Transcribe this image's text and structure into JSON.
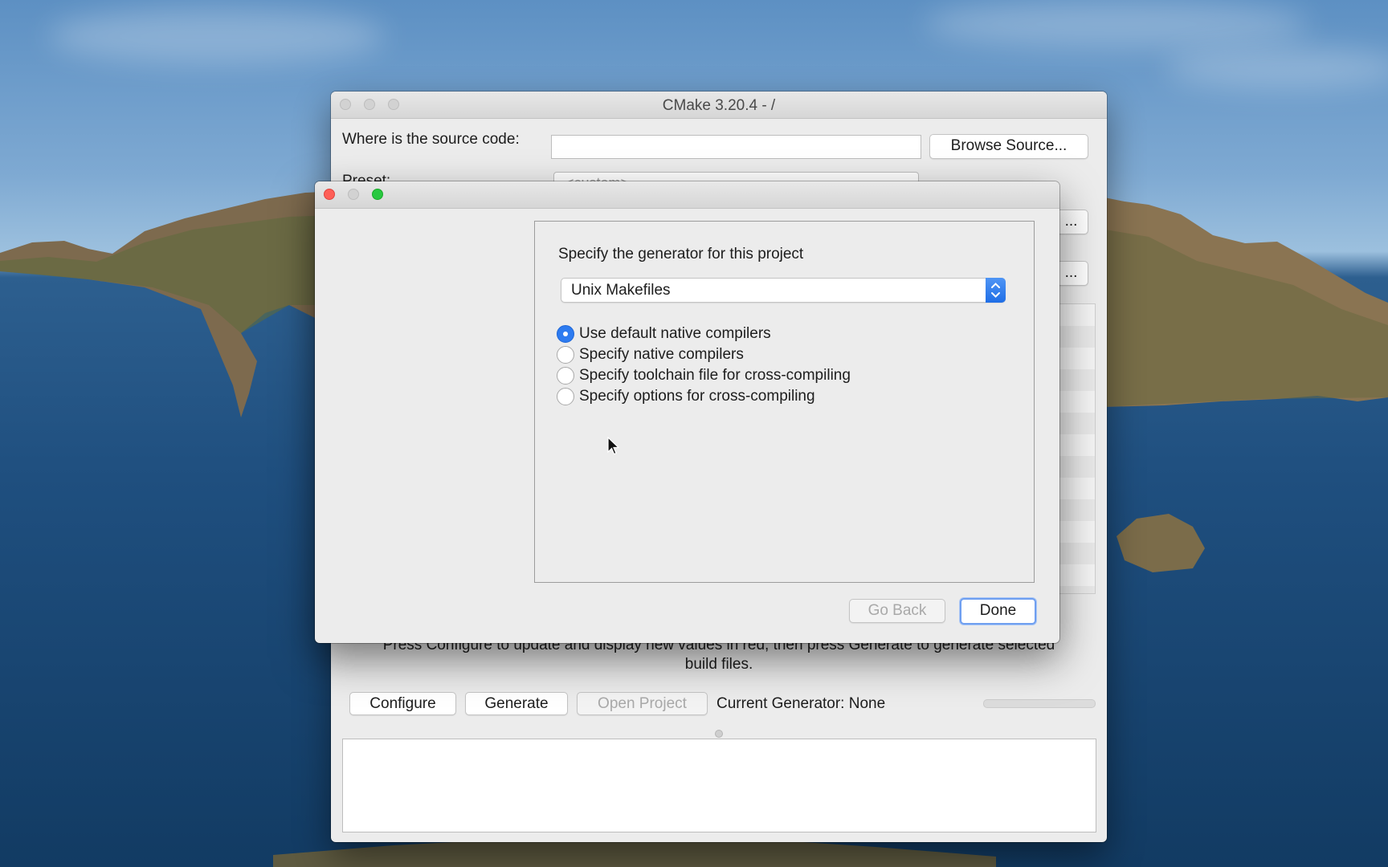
{
  "main_window": {
    "title": "CMake 3.20.4 - /",
    "source_label": "Where is the source code:",
    "source_value": "",
    "browse_source_label": "Browse Source...",
    "preset_label": "Preset:",
    "preset_value": "<custom>",
    "hidden_button_1": "...",
    "hidden_button_2": "...",
    "hint_line_1": "Press Configure to update and display new values in red, then press Generate to generate selected",
    "hint_line_2": "build files.",
    "configure_label": "Configure",
    "generate_label": "Generate",
    "open_project_label": "Open Project",
    "current_generator_text": "Current Generator: None",
    "output_text": ""
  },
  "dialog": {
    "heading": "Specify the generator for this project",
    "generator_selected": "Unix Makefiles",
    "options": [
      {
        "label": "Use default native compilers",
        "selected": true
      },
      {
        "label": "Specify native compilers",
        "selected": false
      },
      {
        "label": "Specify toolchain file for cross-compiling",
        "selected": false
      },
      {
        "label": "Specify options for cross-compiling",
        "selected": false
      }
    ],
    "go_back_label": "Go Back",
    "done_label": "Done"
  },
  "colors": {
    "accent": "#2d7bf0",
    "close": "#fe5f57",
    "zoom": "#28c840"
  },
  "icons": [
    "close-icon",
    "minimize-icon",
    "zoom-icon",
    "chevron-updown-icon",
    "cursor-icon"
  ]
}
